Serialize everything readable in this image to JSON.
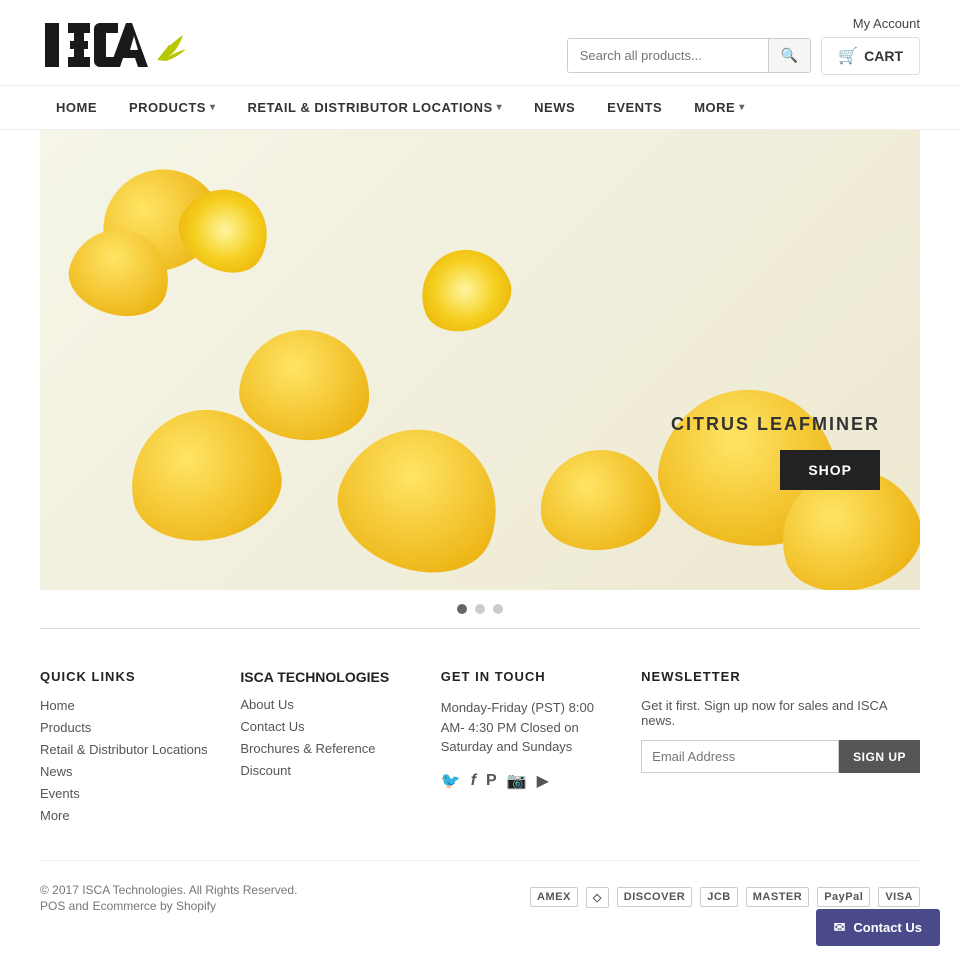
{
  "header": {
    "my_account_label": "My Account",
    "search_placeholder": "Search all products...",
    "search_button_label": "🔍",
    "cart_label": "CART",
    "cart_icon": "🛒"
  },
  "nav": {
    "items": [
      {
        "label": "HOME",
        "has_dropdown": false
      },
      {
        "label": "PRODUCTS",
        "has_dropdown": true
      },
      {
        "label": "RETAIL & DISTRIBUTOR LOCATIONS",
        "has_dropdown": true
      },
      {
        "label": "NEWS",
        "has_dropdown": false
      },
      {
        "label": "EVENTS",
        "has_dropdown": false
      },
      {
        "label": "MORE",
        "has_dropdown": true
      }
    ]
  },
  "hero": {
    "product_name": "CITRUS LEAFMINER",
    "shop_button": "SHOP",
    "slides": 3,
    "active_slide": 0
  },
  "footer": {
    "quick_links": {
      "title": "QUICK LINKS",
      "items": [
        {
          "label": "Home"
        },
        {
          "label": "Products"
        },
        {
          "label": "Retail & Distributor Locations"
        },
        {
          "label": "News"
        },
        {
          "label": "Events"
        },
        {
          "label": "More"
        }
      ]
    },
    "isca_tech": {
      "title": "ISCA TECHNOLOGIES",
      "links": [
        {
          "label": "About Us"
        },
        {
          "label": "Contact Us"
        },
        {
          "label": "Brochures & Reference"
        },
        {
          "label": "Discount"
        }
      ]
    },
    "get_in_touch": {
      "title": "GET IN TOUCH",
      "hours": "Monday-Friday (PST) 8:00 AM- 4:30 PM Closed on Saturday and Sundays",
      "social": [
        {
          "name": "Twitter",
          "icon": "🐦"
        },
        {
          "name": "Facebook",
          "icon": "f"
        },
        {
          "name": "Pinterest",
          "icon": "P"
        },
        {
          "name": "Instagram",
          "icon": "📷"
        },
        {
          "name": "YouTube",
          "icon": "▶"
        }
      ]
    },
    "newsletter": {
      "title": "NEWSLETTER",
      "description": "Get it first. Sign up now for sales and ISCA news.",
      "email_placeholder": "Email Address",
      "signup_button": "SIGN UP"
    },
    "bottom": {
      "copyright": "© 2017 ISCA Technologies. All Rights Reserved.",
      "pos_text": "POS and",
      "ecommerce_text": "Ecommerce by Shopify",
      "payment_methods": [
        {
          "label": "AMEX",
          "name": "American Express"
        },
        {
          "label": "◇",
          "name": "Diners"
        },
        {
          "label": "DISCOVER",
          "name": "Discover"
        },
        {
          "label": "JCB",
          "name": "JCB"
        },
        {
          "label": "MASTER",
          "name": "Mastercard"
        },
        {
          "label": "PayPal",
          "name": "PayPal"
        },
        {
          "label": "VISA",
          "name": "Visa"
        }
      ]
    }
  },
  "float_button": {
    "label": "Contact Us",
    "icon": "✉"
  }
}
